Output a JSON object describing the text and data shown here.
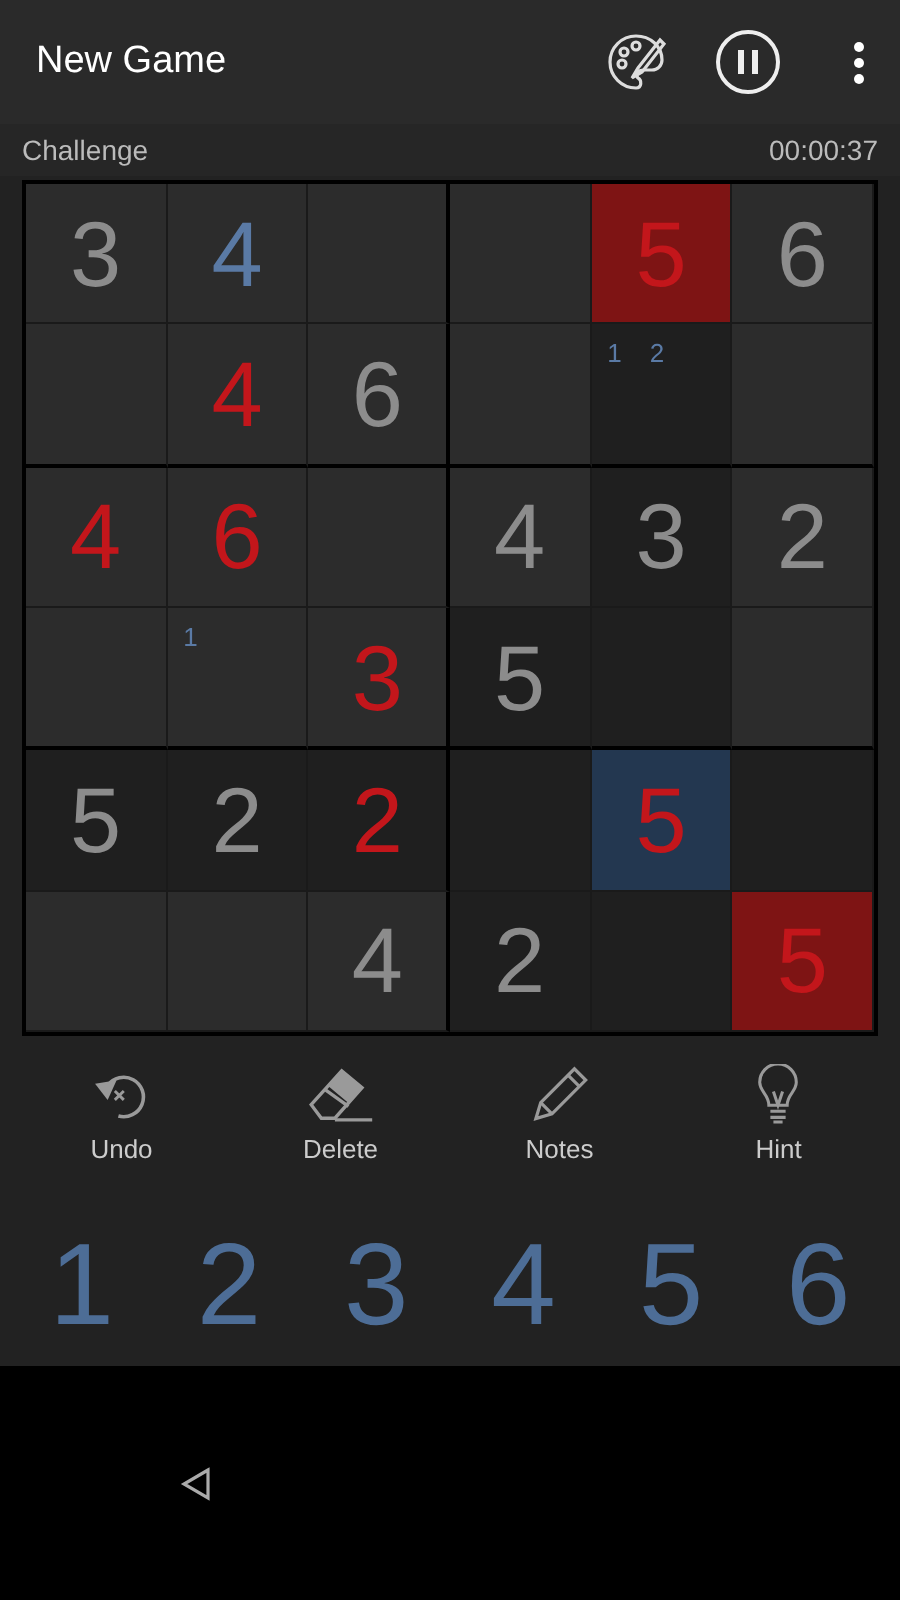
{
  "app_bar": {
    "title": "New Game"
  },
  "info": {
    "difficulty": "Challenge",
    "timer": "00:00:37"
  },
  "grid": {
    "rows": [
      [
        {
          "value": "3",
          "kind": "given",
          "highlighted": false,
          "conflict": false,
          "selected": false
        },
        {
          "value": "4",
          "kind": "user",
          "highlighted": false,
          "conflict": false,
          "selected": false
        },
        {
          "highlighted": false,
          "conflict": false,
          "selected": false
        },
        {
          "highlighted": false,
          "conflict": false,
          "selected": false
        },
        {
          "value": "5",
          "kind": "error",
          "highlighted": false,
          "conflict": true,
          "selected": false
        },
        {
          "value": "6",
          "kind": "given",
          "highlighted": false,
          "conflict": false,
          "selected": false
        }
      ],
      [
        {
          "highlighted": false,
          "conflict": false,
          "selected": false
        },
        {
          "value": "4",
          "kind": "error",
          "highlighted": false,
          "conflict": false,
          "selected": false
        },
        {
          "value": "6",
          "kind": "given",
          "highlighted": false,
          "conflict": false,
          "selected": false
        },
        {
          "highlighted": false,
          "conflict": false,
          "selected": false
        },
        {
          "notes": [
            "1",
            "2"
          ],
          "highlighted": true,
          "conflict": false,
          "selected": false
        },
        {
          "highlighted": false,
          "conflict": false,
          "selected": false
        }
      ],
      [
        {
          "value": "4",
          "kind": "error",
          "highlighted": false,
          "conflict": false,
          "selected": false
        },
        {
          "value": "6",
          "kind": "error",
          "highlighted": false,
          "conflict": false,
          "selected": false
        },
        {
          "highlighted": false,
          "conflict": false,
          "selected": false
        },
        {
          "value": "4",
          "kind": "given",
          "highlighted": false,
          "conflict": false,
          "selected": false
        },
        {
          "value": "3",
          "kind": "given",
          "highlighted": true,
          "conflict": false,
          "selected": false
        },
        {
          "value": "2",
          "kind": "given",
          "highlighted": false,
          "conflict": false,
          "selected": false
        }
      ],
      [
        {
          "highlighted": false,
          "conflict": false,
          "selected": false
        },
        {
          "notes": [
            "1"
          ],
          "highlighted": false,
          "conflict": false,
          "selected": false
        },
        {
          "value": "3",
          "kind": "error",
          "highlighted": false,
          "conflict": false,
          "selected": false
        },
        {
          "value": "5",
          "kind": "given",
          "highlighted": true,
          "conflict": false,
          "selected": false
        },
        {
          "highlighted": true,
          "conflict": false,
          "selected": false
        },
        {
          "highlighted": false,
          "conflict": false,
          "selected": false
        }
      ],
      [
        {
          "value": "5",
          "kind": "given",
          "highlighted": true,
          "conflict": false,
          "selected": false
        },
        {
          "value": "2",
          "kind": "given",
          "highlighted": true,
          "conflict": false,
          "selected": false
        },
        {
          "value": "2",
          "kind": "error",
          "highlighted": true,
          "conflict": false,
          "selected": false
        },
        {
          "highlighted": true,
          "conflict": false,
          "selected": false
        },
        {
          "value": "5",
          "kind": "error",
          "highlighted": false,
          "conflict": false,
          "selected": true
        },
        {
          "highlighted": true,
          "conflict": false,
          "selected": false
        }
      ],
      [
        {
          "highlighted": false,
          "conflict": false,
          "selected": false
        },
        {
          "highlighted": false,
          "conflict": false,
          "selected": false
        },
        {
          "value": "4",
          "kind": "given",
          "highlighted": false,
          "conflict": false,
          "selected": false
        },
        {
          "value": "2",
          "kind": "given",
          "highlighted": true,
          "conflict": false,
          "selected": false
        },
        {
          "highlighted": true,
          "conflict": false,
          "selected": false
        },
        {
          "value": "5",
          "kind": "error",
          "highlighted": false,
          "conflict": true,
          "selected": false
        }
      ]
    ]
  },
  "tools": [
    {
      "kind": "undo",
      "label": "Undo"
    },
    {
      "kind": "delete",
      "label": "Delete"
    },
    {
      "kind": "notes",
      "label": "Notes"
    },
    {
      "kind": "hint",
      "label": "Hint"
    }
  ],
  "number_pad": [
    "1",
    "2",
    "3",
    "4",
    "5",
    "6"
  ]
}
